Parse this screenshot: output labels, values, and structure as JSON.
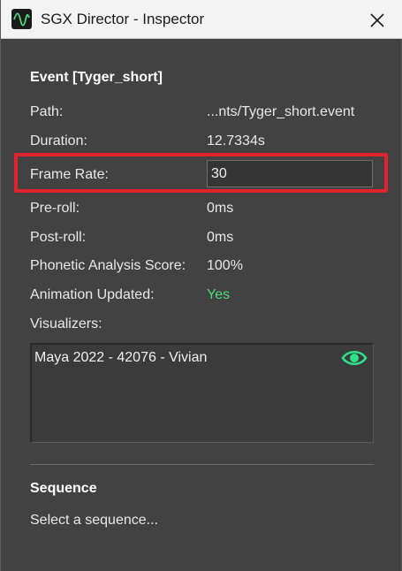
{
  "window": {
    "title": "SGX Director - Inspector",
    "app_icon": "waveform-icon",
    "close_icon": "close-icon"
  },
  "event": {
    "header": "Event [Tyger_short]",
    "path_label": "Path:",
    "path_value": "...nts/Tyger_short.event",
    "duration_label": "Duration:",
    "duration_value": "12.7334s",
    "frame_rate_label": "Frame Rate:",
    "frame_rate_value": "30",
    "preroll_label": "Pre-roll:",
    "preroll_value": "0ms",
    "postroll_label": "Post-roll:",
    "postroll_value": "0ms",
    "phonetic_label": "Phonetic Analysis Score:",
    "phonetic_value": "100%",
    "anim_label": "Animation Updated:",
    "anim_value": "Yes",
    "visualizers_label": "Visualizers:",
    "visualizers": [
      {
        "name": "Maya 2022 - 42076 - Vivian",
        "icon": "eye-icon"
      }
    ]
  },
  "sequence": {
    "header": "Sequence",
    "placeholder": "Select a sequence..."
  },
  "colors": {
    "highlight": "#e0232e",
    "accent_green": "#4bdc7a",
    "panel_bg": "#424242"
  }
}
